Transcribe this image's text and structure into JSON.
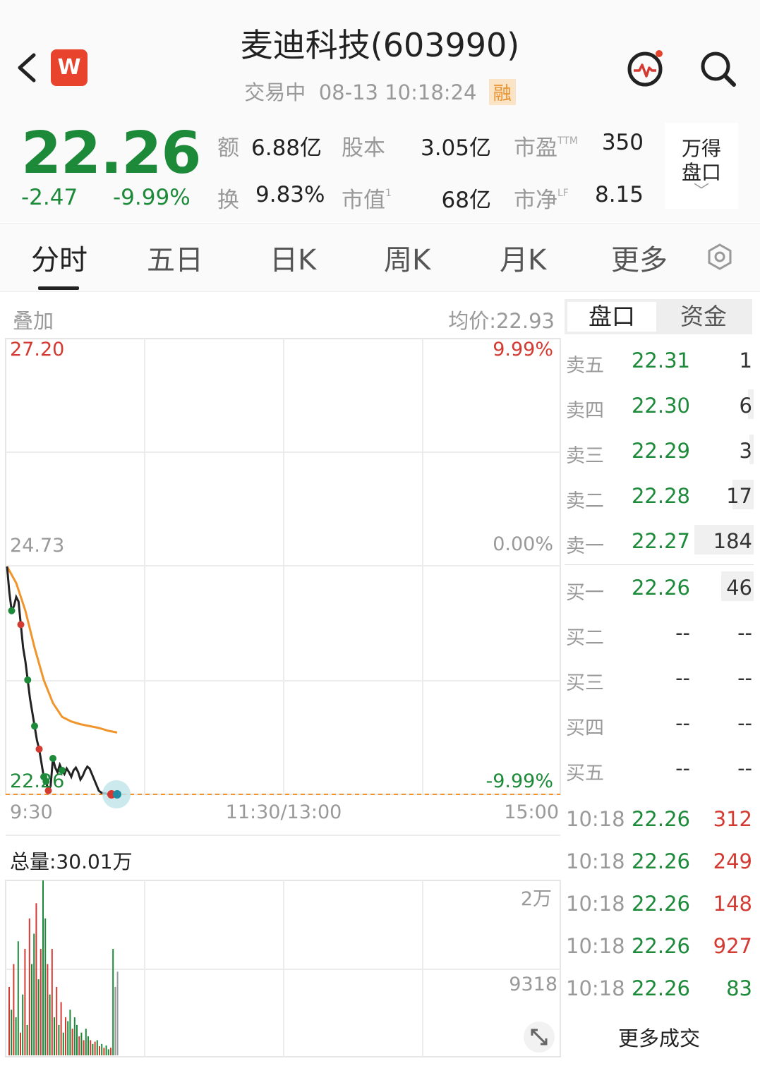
{
  "header": {
    "title": "麦迪科技(603990)",
    "status": "交易中",
    "datetime": "08-13 10:18:24",
    "margin_badge": "融",
    "logo_letter": "W"
  },
  "quote": {
    "price": "22.26",
    "change": "-2.47",
    "change_pct": "-9.99%",
    "stats": [
      {
        "label": "额",
        "value": "6.88亿"
      },
      {
        "label": "股本",
        "value": "3.05亿"
      },
      {
        "label": "市盈",
        "sup": "TTM",
        "value": "350"
      },
      {
        "label": "换",
        "value": "9.83%"
      },
      {
        "label": "市值",
        "sup": "1",
        "value": "68亿"
      },
      {
        "label": "市净",
        "sup": "LF",
        "value": "8.15"
      }
    ],
    "wind_panel": {
      "line1": "万得",
      "line2": "盘口",
      "chevron": "﹀"
    }
  },
  "tabs": [
    "分时",
    "五日",
    "日K",
    "周K",
    "月K",
    "更多"
  ],
  "chart": {
    "overlay_label": "叠加",
    "avg_label": "均价:22.93",
    "price_high": "27.20",
    "price_mid": "24.73",
    "price_low": "22.26",
    "pct_high": "9.99%",
    "pct_mid": "0.00%",
    "pct_low": "-9.99%",
    "time_start": "9:30",
    "time_mid": "11:30/13:00",
    "time_end": "15:00",
    "volume_total": "总量:30.01万",
    "vol_high": "2万",
    "vol_mid": "9318"
  },
  "chart_data": {
    "type": "line",
    "x_domain": [
      "9:30",
      "15:00"
    ],
    "ylim": [
      22.26,
      27.2
    ],
    "series": [
      {
        "x": [
          0,
          1,
          2,
          3,
          4,
          5,
          6,
          7,
          8,
          9,
          10,
          11,
          12,
          13,
          14,
          15,
          16,
          17,
          18,
          19,
          20,
          21,
          22,
          23,
          24,
          25,
          26,
          27,
          28,
          29,
          30,
          31,
          32,
          33,
          34,
          35,
          36,
          37,
          38,
          39,
          40,
          41,
          42,
          43,
          44,
          45,
          46,
          47,
          48
        ],
        "values": [
          24.73,
          24.45,
          24.25,
          24.3,
          24.4,
          24.35,
          24.1,
          23.85,
          23.7,
          23.5,
          23.3,
          23.15,
          23.0,
          22.85,
          22.75,
          22.6,
          22.45,
          22.4,
          22.3,
          22.35,
          22.65,
          22.55,
          22.5,
          22.58,
          22.52,
          22.48,
          22.54,
          22.5,
          22.45,
          22.52,
          22.55,
          22.5,
          22.42,
          22.46,
          22.52,
          22.56,
          22.54,
          22.48,
          22.42,
          22.36,
          22.3,
          22.28,
          22.27,
          22.27,
          22.26,
          22.26,
          22.26,
          22.26,
          22.26
        ]
      },
      {
        "x": [
          0,
          4,
          8,
          12,
          16,
          20,
          24,
          28,
          32,
          36,
          40,
          44,
          48
        ],
        "values": [
          24.73,
          24.55,
          24.25,
          23.85,
          23.5,
          23.25,
          23.1,
          23.05,
          23.02,
          23.0,
          22.98,
          22.95,
          22.93
        ]
      }
    ],
    "volume": {
      "ylim": [
        0,
        23000
      ],
      "values": [
        9000,
        6000,
        12000,
        5000,
        15000,
        3000,
        8000,
        14000,
        4000,
        18000,
        12000,
        16000,
        20000,
        10000,
        14000,
        23000,
        18000,
        12000,
        8000,
        14000,
        5000,
        9000,
        4000,
        7000,
        3000,
        5000,
        4500,
        6000,
        3500,
        5000,
        4000,
        2500,
        3000,
        2000,
        3500,
        2500,
        2000,
        1500,
        1800,
        2000,
        1200,
        1500,
        1000,
        1300,
        800,
        1000,
        14000,
        9000,
        11000
      ],
      "colors": [
        "r",
        "g",
        "r",
        "g",
        "g",
        "r",
        "g",
        "r",
        "g",
        "r",
        "g",
        "g",
        "r",
        "g",
        "r",
        "g",
        "g",
        "r",
        "g",
        "r",
        "g",
        "r",
        "g",
        "r",
        "g",
        "r",
        "g",
        "g",
        "r",
        "g",
        "g",
        "r",
        "g",
        "r",
        "g",
        "g",
        "r",
        "g",
        "r",
        "g",
        "r",
        "g",
        "r",
        "g",
        "g",
        "r",
        "g",
        "gray",
        "gray"
      ]
    }
  },
  "book": {
    "tab_pankou": "盘口",
    "tab_zijin": "资金",
    "asks": [
      {
        "name": "卖五",
        "price": "22.31",
        "vol": "1"
      },
      {
        "name": "卖四",
        "price": "22.30",
        "vol": "6"
      },
      {
        "name": "卖三",
        "price": "22.29",
        "vol": "3"
      },
      {
        "name": "卖二",
        "price": "22.28",
        "vol": "17"
      },
      {
        "name": "卖一",
        "price": "22.27",
        "vol": "184"
      }
    ],
    "bids": [
      {
        "name": "买一",
        "price": "22.26",
        "vol": "46"
      },
      {
        "name": "买二",
        "price": "--",
        "vol": "--"
      },
      {
        "name": "买三",
        "price": "--",
        "vol": "--"
      },
      {
        "name": "买四",
        "price": "--",
        "vol": "--"
      },
      {
        "name": "买五",
        "price": "--",
        "vol": "--"
      }
    ],
    "trades": [
      {
        "time": "10:18",
        "price": "22.26",
        "vol": "312",
        "side": "red"
      },
      {
        "time": "10:18",
        "price": "22.26",
        "vol": "249",
        "side": "red"
      },
      {
        "time": "10:18",
        "price": "22.26",
        "vol": "148",
        "side": "red"
      },
      {
        "time": "10:18",
        "price": "22.26",
        "vol": "927",
        "side": "red"
      },
      {
        "time": "10:18",
        "price": "22.26",
        "vol": "83",
        "side": "green"
      }
    ],
    "more_trades": "更多成交"
  },
  "colors": {
    "up": "#d33a31",
    "down": "#1d8a3a",
    "avg_line": "#f0952b",
    "price_line": "#222222"
  }
}
